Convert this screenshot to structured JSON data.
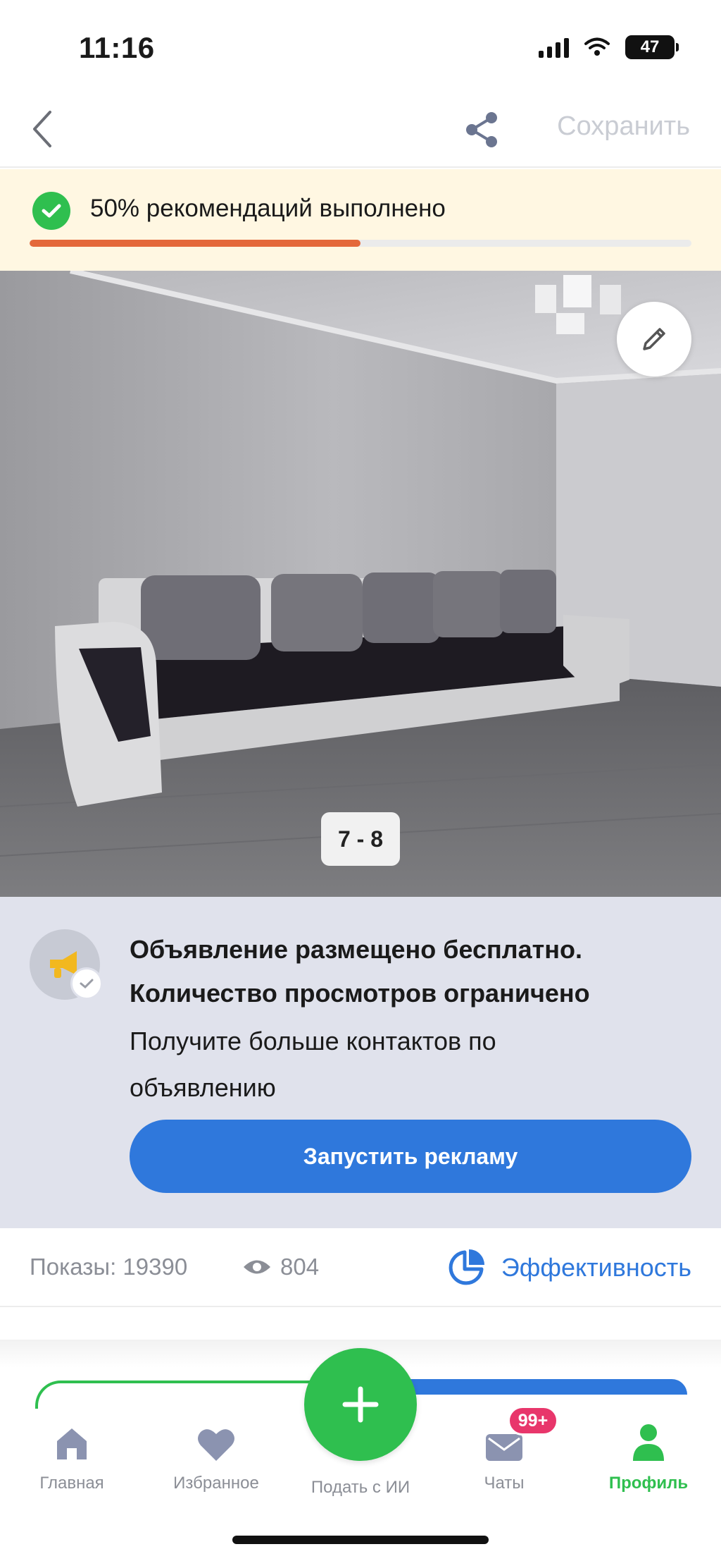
{
  "status_bar": {
    "time": "11:16",
    "battery": "47"
  },
  "header": {
    "save_label": "Сохранить"
  },
  "progress": {
    "text": "50% рекомендаций выполнено",
    "value": 0.5,
    "color": "#e4683a"
  },
  "photo": {
    "counter": "7 - 8"
  },
  "promo": {
    "title": "Объявление размещено бесплатно. Количество просмотров ограничено",
    "subtitle": "Получите больше контактов по объявлению",
    "button_label": "Запустить рекламу"
  },
  "stats": {
    "impressions": "Показы: 19390",
    "views": "804",
    "efficiency_label": "Эффективность"
  },
  "bottom_nav": {
    "fab_label": "Подать с ИИ",
    "items": [
      {
        "label": "Главная",
        "icon": "home-icon"
      },
      {
        "label": "Избранное",
        "icon": "heart-icon"
      },
      {
        "label": "Чаты",
        "icon": "chat-icon",
        "badge": "99+"
      },
      {
        "label": "Профиль",
        "icon": "profile-icon",
        "active": true
      }
    ]
  },
  "colors": {
    "accent_blue": "#2f78dc",
    "accent_green": "#2fbf4f",
    "badge_pink": "#e8366b"
  }
}
